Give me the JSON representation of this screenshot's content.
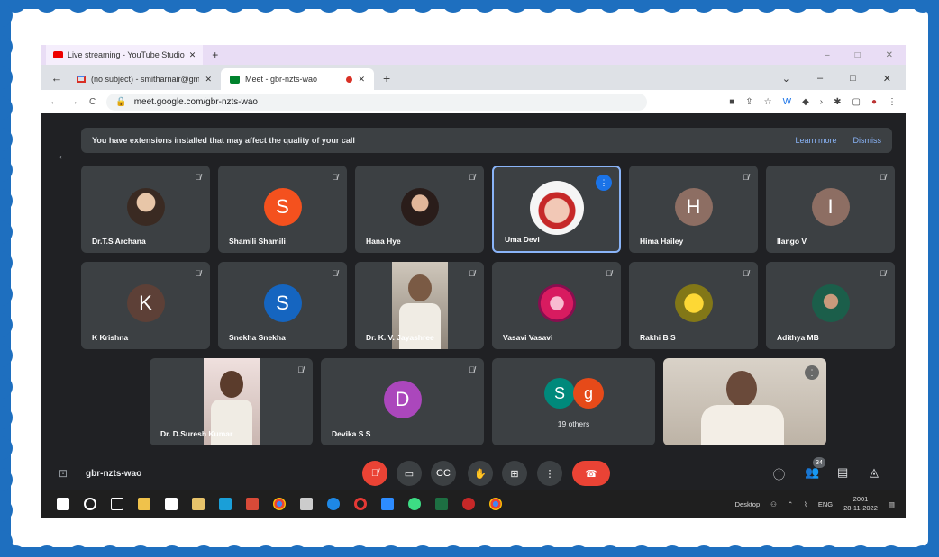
{
  "outer_tab": {
    "title": "Live streaming - YouTube Studio",
    "close": "✕",
    "new": "+"
  },
  "tabs": [
    {
      "title": "(no subject) - smitharnair@gm...",
      "close": "✕"
    },
    {
      "title": "Meet - gbr-nzts-wao",
      "close": "✕"
    }
  ],
  "new_tab": "+",
  "window_controls": {
    "minimize": "–",
    "maximize": "□",
    "close": "✕",
    "dropdown": "⌄"
  },
  "address": {
    "url": "meet.google.com/gbr-nzts-wao"
  },
  "banner": {
    "message": "You have extensions installed that may affect the quality of your call",
    "learn_more": "Learn more",
    "dismiss": "Dismiss"
  },
  "participants": [
    {
      "name": "Dr.T.S Archana",
      "initial": "",
      "color": ""
    },
    {
      "name": "Shamili Shamili",
      "initial": "S",
      "color": "#f4511e"
    },
    {
      "name": "Hana Hye",
      "initial": "",
      "color": ""
    },
    {
      "name": "Uma Devi",
      "initial": "",
      "color": "",
      "speaking": true
    },
    {
      "name": "Hima Hailey",
      "initial": "H",
      "color": "#8d6e63"
    },
    {
      "name": "Ilango V",
      "initial": "I",
      "color": "#8d6e63"
    },
    {
      "name": "K Krishna",
      "initial": "K",
      "color": "#5d4037"
    },
    {
      "name": "Snekha Snekha",
      "initial": "S",
      "color": "#1565c0"
    },
    {
      "name": "Dr. K. V. Jayashree",
      "initial": "",
      "color": ""
    },
    {
      "name": "Vasavi Vasavi",
      "initial": "",
      "color": ""
    },
    {
      "name": "Rakhi B S",
      "initial": "",
      "color": ""
    },
    {
      "name": "Adithya MB",
      "initial": "",
      "color": ""
    },
    {
      "name": "Dr. D.Suresh Kumar",
      "initial": "",
      "color": ""
    },
    {
      "name": "Devika S S",
      "initial": "D",
      "color": "#ab47bc"
    }
  ],
  "others": {
    "avatars": [
      "S",
      "g"
    ],
    "label": "19 others"
  },
  "meeting_code": "gbr-nzts-wao",
  "people_count": "34",
  "taskbar": {
    "desktop": "Desktop",
    "lang": "ENG",
    "time": "2001",
    "date": "28-11-2022"
  },
  "colors": {
    "meet_bg": "#202124",
    "tile_bg": "#3c4043",
    "accent": "#8ab4f8",
    "hangup": "#ea4335"
  }
}
